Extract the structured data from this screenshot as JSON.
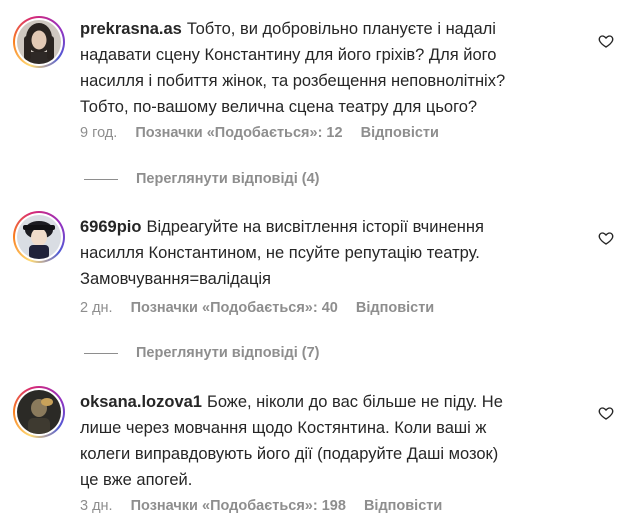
{
  "comments": [
    {
      "username": "prekrasna.as",
      "lines": [
        "Тобто, ви добровільно плануєте і надалі",
        "надавати сцену Константину для його гріхів? Для його",
        "насилля і побиття жінок, та розбещення неповнолітніх?",
        "Тобто, по-вашому велична сцена театру для цього?"
      ],
      "time": "9 год.",
      "likes": "Позначки «Подобається»: 12",
      "reply_label": "Відповісти",
      "view_replies": "Переглянути відповіді (4)",
      "avatar_icon": "profile-photo-woman-icon"
    },
    {
      "username": "6969pio",
      "lines": [
        "Відреагуйте на висвітлення історії вчинення",
        "насилля Константином, не псуйте репутацію театру.",
        "Замовчування=валідація"
      ],
      "time": "2 дн.",
      "likes": "Позначки «Подобається»: 40",
      "reply_label": "Відповісти",
      "view_replies": "Переглянути відповіді (7)",
      "avatar_icon": "profile-photo-character-icon"
    },
    {
      "username": "oksana.lozova1",
      "lines": [
        "Боже, ніколи до вас більше не піду. Не",
        "лише через мовчання щодо Костянтина. Коли ваші ж",
        "колеги виправдовують його дії (подаруйте Даші мозок)",
        "це вже апогей."
      ],
      "time": "3 дн.",
      "likes": "Позначки «Подобається»: 198",
      "reply_label": "Відповісти",
      "avatar_icon": "profile-photo-dark-icon"
    }
  ],
  "colors": {
    "text": "#262626",
    "secondary": "#8e8e8e"
  }
}
